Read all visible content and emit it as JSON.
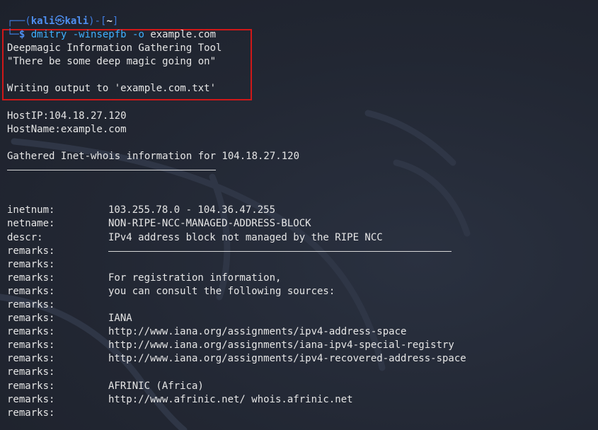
{
  "colors": {
    "background": "#222733",
    "prompt_blue": "#4f8ff0",
    "command_blue": "#3fb0ff",
    "text": "#e6e6e6",
    "highlight_red": "#d01818"
  },
  "prompt": {
    "corner_top": "┌──(",
    "user": "kali",
    "skull": "㉿",
    "host": "kali",
    "close_paren": ")-[",
    "dir": "~",
    "close_bracket": "]",
    "corner_bottom": "└─",
    "dollar": "$ "
  },
  "command": {
    "name": "dmitry",
    "flags": "-winsepfb -o",
    "arg": "example.com"
  },
  "output": {
    "banner_title": "Deepmagic Information Gathering Tool",
    "banner_tagline": "\"There be some deep magic going on\"",
    "writing_output": "Writing output to 'example.com.txt'",
    "host_ip": "HostIP:104.18.27.120",
    "host_name": "HostName:example.com",
    "whois_header": "Gathered Inet-whois information for 104.18.27.120"
  },
  "whois_rows": [
    {
      "key": "inetnum:",
      "value": "103.255.78.0 - 104.36.47.255"
    },
    {
      "key": "netname:",
      "value": "NON-RIPE-NCC-MANAGED-ADDRESS-BLOCK"
    },
    {
      "key": "descr:",
      "value": "IPv4 address block not managed by the RIPE NCC"
    },
    {
      "key": "remarks:",
      "value": "",
      "rule": true
    },
    {
      "key": "remarks:",
      "value": ""
    },
    {
      "key": "remarks:",
      "value": "For registration information,"
    },
    {
      "key": "remarks:",
      "value": "you can consult the following sources:"
    },
    {
      "key": "remarks:",
      "value": ""
    },
    {
      "key": "remarks:",
      "value": "IANA"
    },
    {
      "key": "remarks:",
      "value": "http://www.iana.org/assignments/ipv4-address-space"
    },
    {
      "key": "remarks:",
      "value": "http://www.iana.org/assignments/iana-ipv4-special-registry"
    },
    {
      "key": "remarks:",
      "value": "http://www.iana.org/assignments/ipv4-recovered-address-space"
    },
    {
      "key": "remarks:",
      "value": ""
    },
    {
      "key": "remarks:",
      "value": "AFRINIC (Africa)"
    },
    {
      "key": "remarks:",
      "value": "http://www.afrinic.net/ whois.afrinic.net"
    },
    {
      "key": "remarks:",
      "value": ""
    }
  ]
}
